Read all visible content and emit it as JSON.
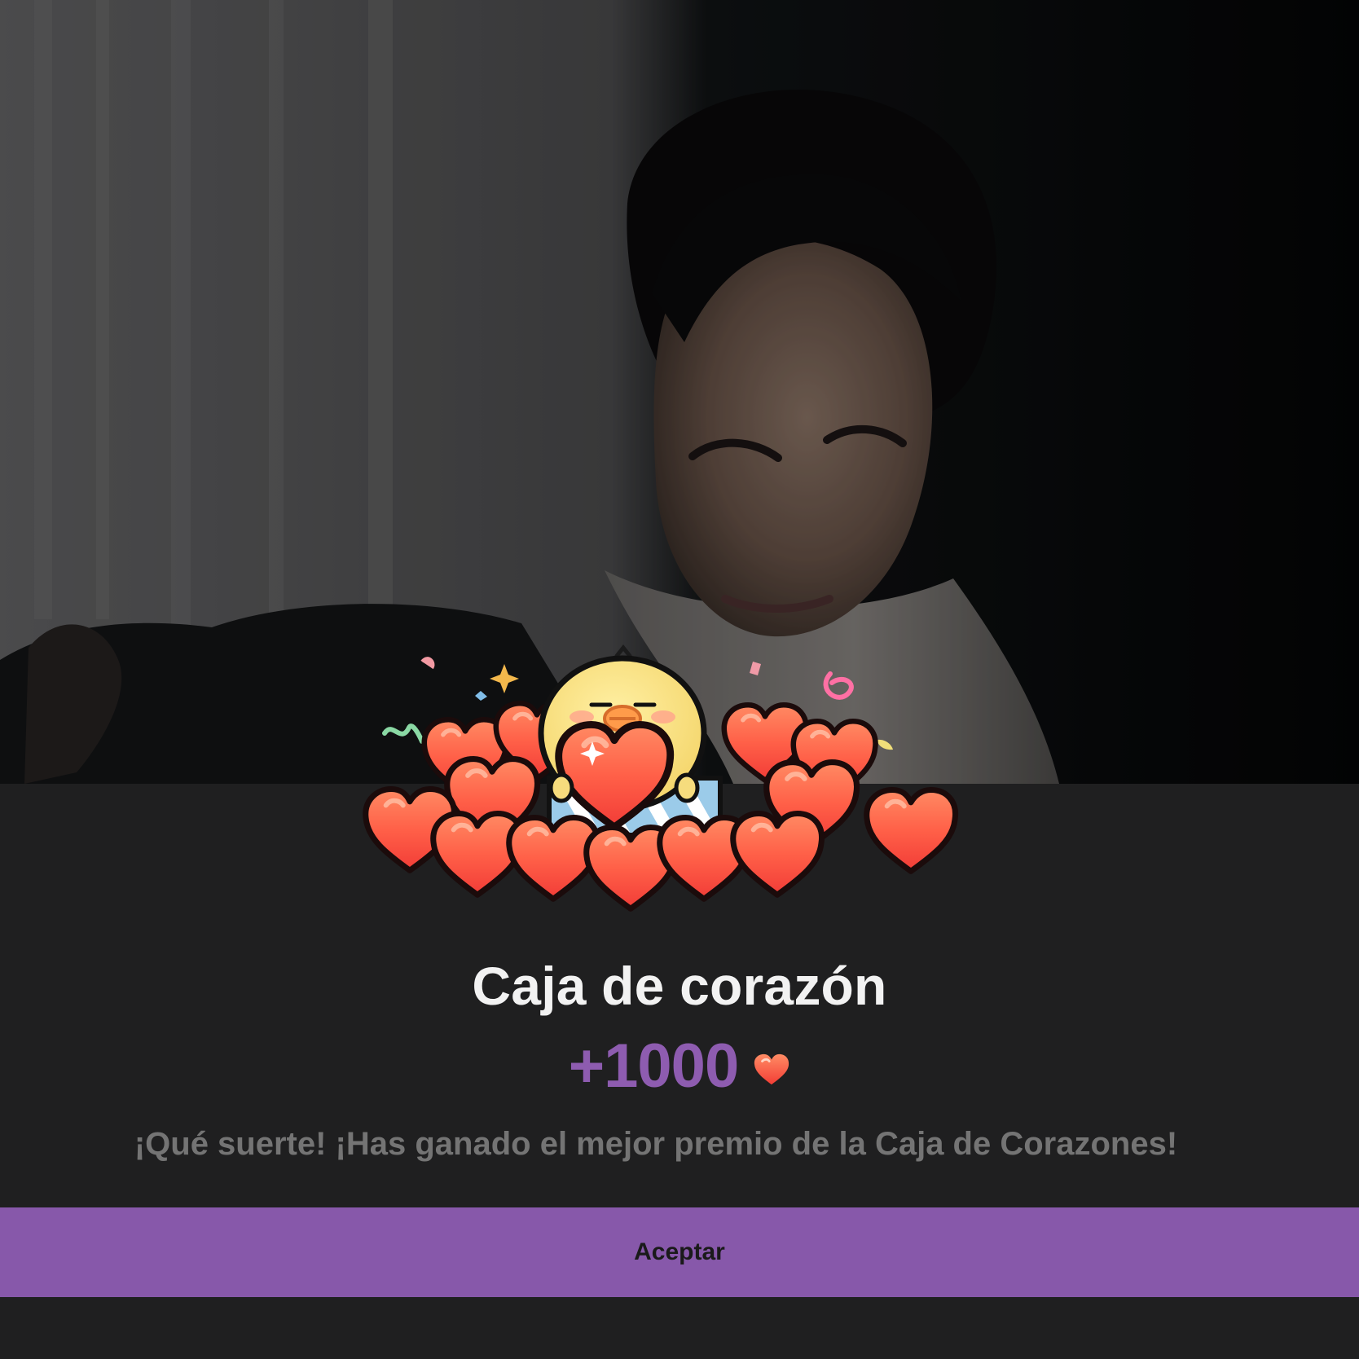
{
  "reward_modal": {
    "title": "Caja de corazón",
    "amount": "+1000",
    "currency_icon": "heart-icon",
    "message": "¡Qué suerte! ¡Has ganado el mejor premio de la Caja de Corazones!",
    "accept_label": "Aceptar"
  },
  "colors": {
    "background": "#1f1f20",
    "accent": "#8758aa",
    "amount": "#8e5cb0",
    "title": "#f2f2f2",
    "message": "#747474",
    "heart": "#ff5a4f",
    "chick": "#f6dc7d"
  }
}
